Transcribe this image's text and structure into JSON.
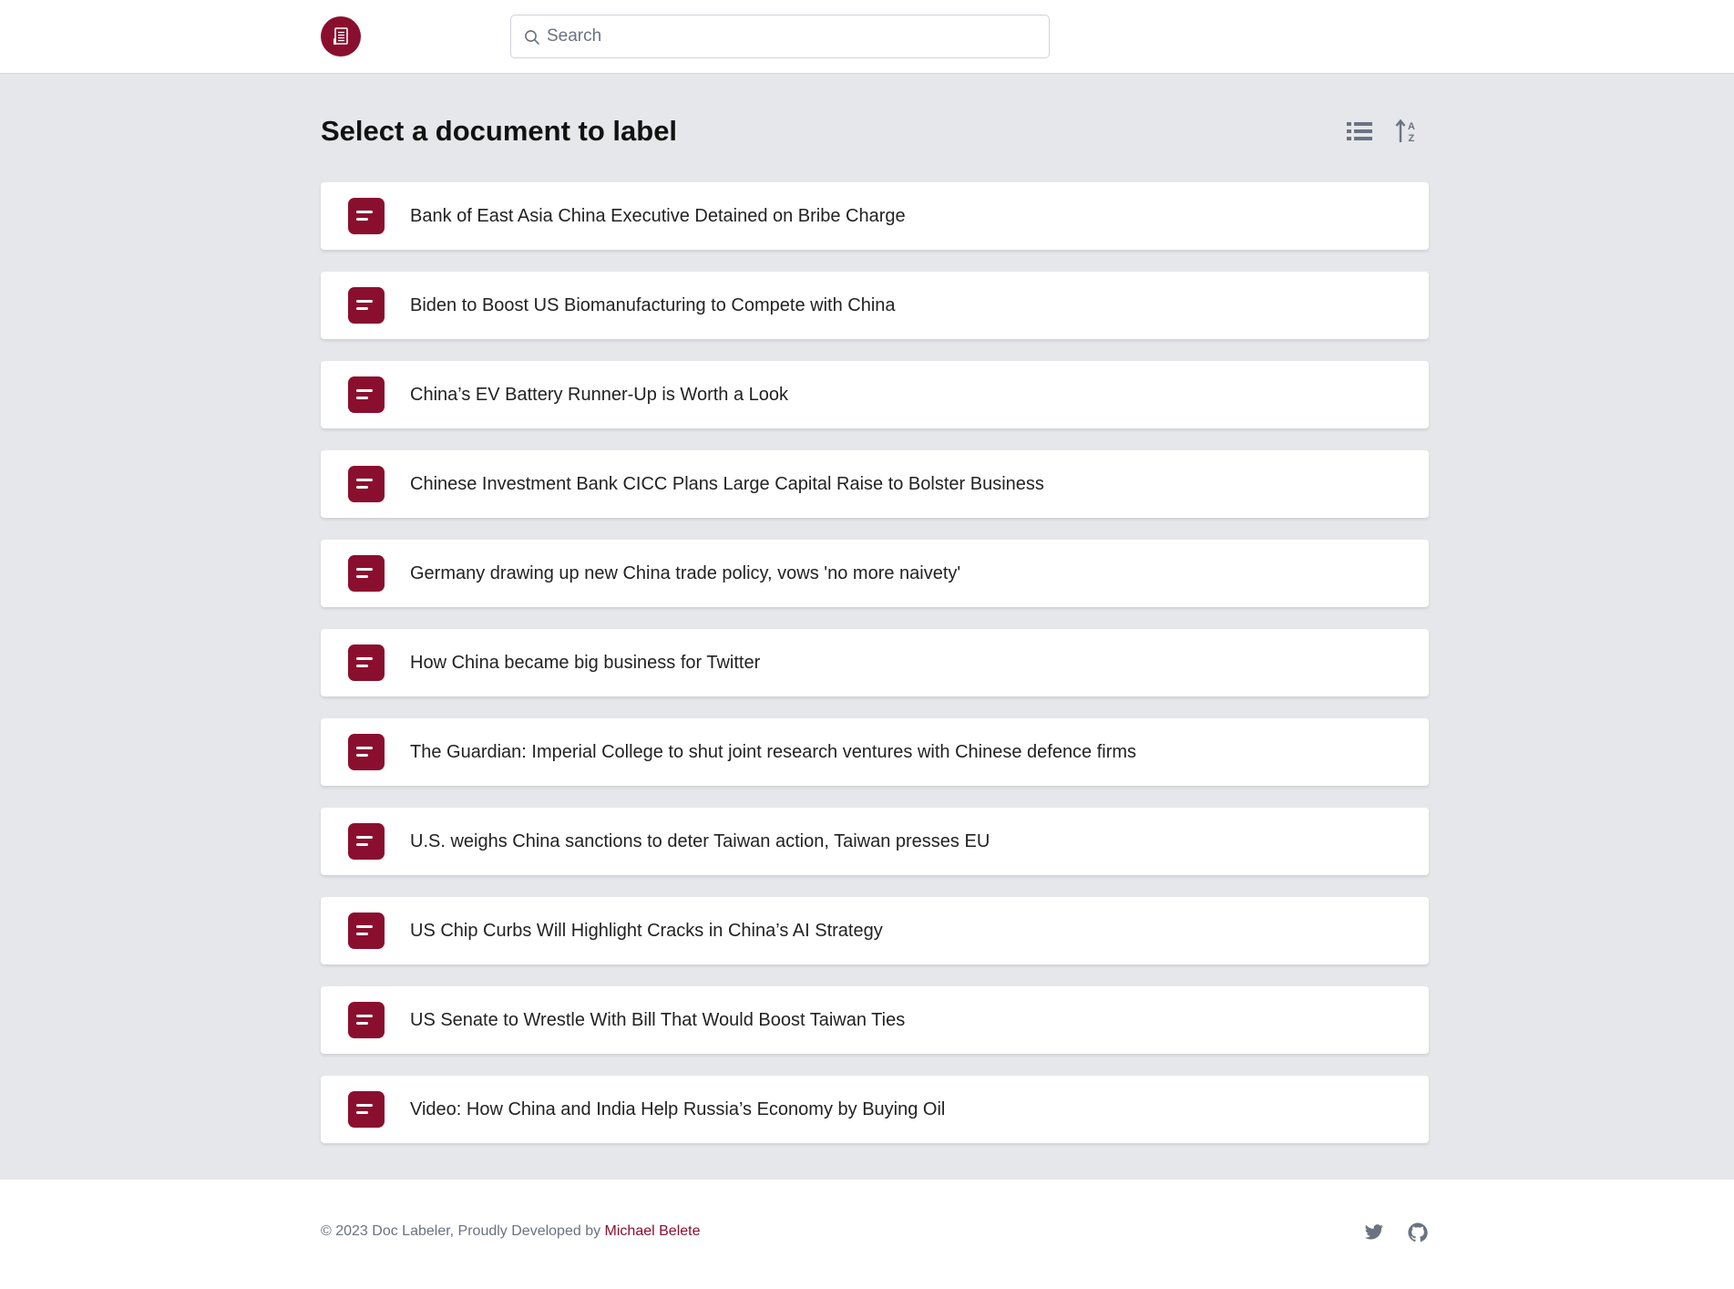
{
  "header": {
    "logo_icon": "document-icon",
    "search": {
      "placeholder": "Search",
      "value": "",
      "icon": "search-icon"
    }
  },
  "main": {
    "title": "Select a document to label",
    "toolbar": {
      "list_view_icon": "list-icon",
      "sort_icon": "sort-alpha-icon"
    },
    "documents": [
      {
        "title": "Bank of East Asia China Executive Detained on Bribe Charge"
      },
      {
        "title": "Biden to Boost US Biomanufacturing to Compete with China"
      },
      {
        "title": "China’s EV Battery Runner-Up is Worth a Look"
      },
      {
        "title": "Chinese Investment Bank CICC Plans Large Capital Raise to Bolster Business"
      },
      {
        "title": "Germany drawing up new China trade policy, vows 'no more naivety'"
      },
      {
        "title": "How China became big business for Twitter"
      },
      {
        "title": "The Guardian: Imperial College to shut joint research ventures with Chinese defence firms"
      },
      {
        "title": "U.S. weighs China sanctions to deter Taiwan action, Taiwan presses EU"
      },
      {
        "title": "US Chip Curbs Will Highlight Cracks in China’s AI Strategy"
      },
      {
        "title": "US Senate to Wrestle With Bill That Would Boost Taiwan Ties"
      },
      {
        "title": "Video: How China and India Help Russia’s Economy by Buying Oil"
      }
    ]
  },
  "footer": {
    "copyright": "© 2023 Doc Labeler, Proudly Developed by ",
    "author": "Michael Belete",
    "social_icons": [
      "twitter-icon",
      "github-icon"
    ]
  },
  "colors": {
    "brand": "#8a0f2e",
    "background": "#e5e7eb",
    "card": "#ffffff"
  }
}
